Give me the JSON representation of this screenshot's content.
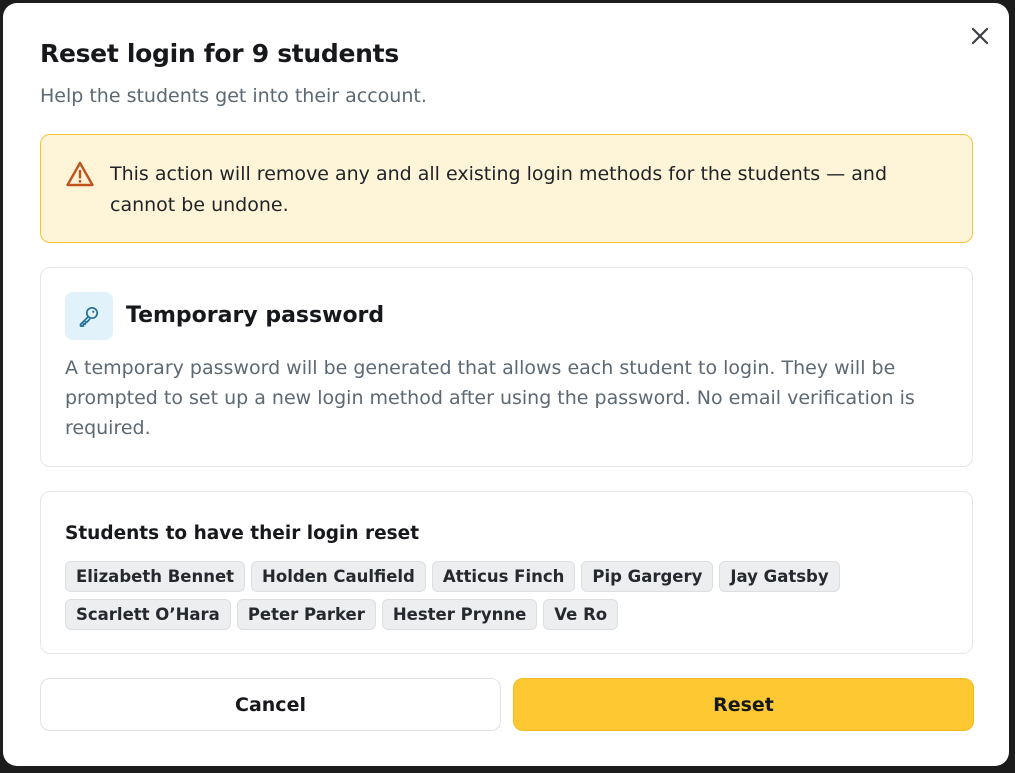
{
  "dialog": {
    "title": "Reset login for 9 students",
    "subtitle": "Help the students get into their account."
  },
  "warning": {
    "icon": "warning-triangle-icon",
    "text": "This action will remove any and all existing login methods for the students — and cannot be undone.",
    "background_color": "#fef5d9",
    "border_color": "#f2c43d",
    "icon_color": "#c0541b"
  },
  "method": {
    "icon": "key-icon",
    "title": "Temporary password",
    "description": "A temporary password will be generated that allows each student to login. They will be prompted to set up a new login method after using the password. No email verification is required."
  },
  "students": {
    "title": "Students to have their login reset",
    "names": [
      "Elizabeth Bennet",
      "Holden Caulfield",
      "Atticus Finch",
      "Pip Gargery",
      "Jay Gatsby",
      "Scarlett O’Hara",
      "Peter Parker",
      "Hester Prynne",
      "Ve Ro"
    ]
  },
  "actions": {
    "cancel_label": "Cancel",
    "reset_label": "Reset",
    "reset_color": "#fdc832"
  },
  "close_icon": "close-icon"
}
